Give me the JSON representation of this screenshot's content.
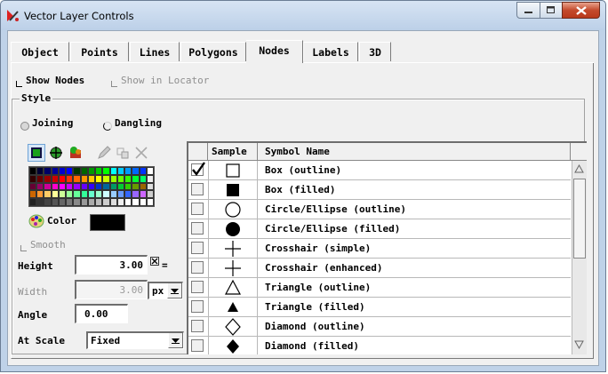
{
  "window": {
    "title": "Vector Layer Controls",
    "controls": {
      "minimize": "minimize",
      "maximize": "maximize",
      "close": "close"
    }
  },
  "tabs": [
    {
      "label": "Object",
      "active": false
    },
    {
      "label": "Points",
      "active": false
    },
    {
      "label": "Lines",
      "active": false
    },
    {
      "label": "Polygons",
      "active": false
    },
    {
      "label": "Nodes",
      "active": true
    },
    {
      "label": "Labels",
      "active": false
    },
    {
      "label": "3D",
      "active": false
    }
  ],
  "options": {
    "show_nodes": {
      "label": "Show Nodes",
      "checked": false
    },
    "show_in_locator": {
      "label": "Show in Locator",
      "checked": false,
      "enabled": false
    }
  },
  "style": {
    "legend": "Style",
    "node_type": {
      "options": [
        "Joining",
        "Dangling"
      ],
      "selected": "Joining"
    },
    "color_label": "Color",
    "color_value": "#000000",
    "smooth": {
      "label": "Smooth",
      "checked": false,
      "enabled": false
    },
    "height": {
      "label": "Height",
      "value": "3.00",
      "link_symbol": "="
    },
    "width": {
      "label": "Width",
      "value": "3.00",
      "unit": "px"
    },
    "angle": {
      "label": "Angle",
      "value": "0.00"
    },
    "at_scale": {
      "label": "At Scale",
      "value": "Fixed"
    }
  },
  "symbol_table": {
    "headers": {
      "sample": "Sample",
      "name": "Symbol Name"
    },
    "rows": [
      {
        "checked": true,
        "shape": "square-outline",
        "name": "Box (outline)"
      },
      {
        "checked": false,
        "shape": "square-filled",
        "name": "Box (filled)"
      },
      {
        "checked": false,
        "shape": "circle-outline",
        "name": "Circle/Ellipse (outline)"
      },
      {
        "checked": false,
        "shape": "circle-filled",
        "name": "Circle/Ellipse (filled)"
      },
      {
        "checked": false,
        "shape": "crosshair-simple",
        "name": "Crosshair (simple)"
      },
      {
        "checked": false,
        "shape": "crosshair-enhanced",
        "name": "Crosshair (enhanced)"
      },
      {
        "checked": false,
        "shape": "triangle-outline",
        "name": "Triangle (outline)"
      },
      {
        "checked": false,
        "shape": "triangle-filled",
        "name": "Triangle (filled)"
      },
      {
        "checked": false,
        "shape": "diamond-outline",
        "name": "Diamond (outline)"
      },
      {
        "checked": false,
        "shape": "diamond-filled",
        "name": "Diamond (filled)"
      }
    ]
  },
  "colors": {
    "titlebar": "#bcd0e8",
    "dialog_bg": "#f0f0f0",
    "close_button": "#c44a2c"
  }
}
